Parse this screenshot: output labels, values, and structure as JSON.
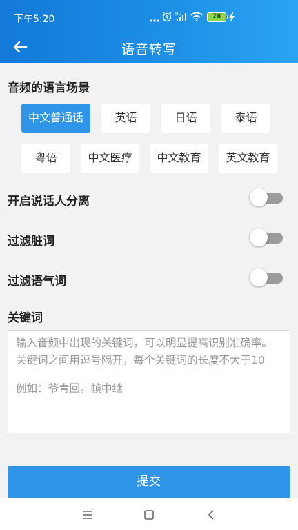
{
  "status_bar": {
    "time": "下午5:20",
    "battery": "78",
    "icons": [
      "more-dots-icon",
      "alarm-icon",
      "signal-icon",
      "wifi-icon",
      "battery-icon",
      "charging-icon"
    ]
  },
  "header": {
    "title": "语音转写",
    "back_icon": "arrow-left-icon",
    "color_start": "#1279d8",
    "color_end": "#2aa4f2"
  },
  "language": {
    "label": "音频的语言场景",
    "options": [
      "中文普通话",
      "英语",
      "日语",
      "泰语",
      "粤语",
      "中文医疗",
      "中文教育",
      "英文教育"
    ],
    "selected": "中文普通话",
    "accent": "#2f95e8"
  },
  "toggles": [
    {
      "label": "开启说话人分离",
      "on": false
    },
    {
      "label": "过滤脏词",
      "on": false
    },
    {
      "label": "过滤语气词",
      "on": false
    }
  ],
  "keywords": {
    "label": "关键词",
    "placeholder": "输入音频中出现的关键词，可以明显提高识别准确率。关键词之间用逗号隔开，每个关键词的长度不大于10",
    "example": "例如：爷青回，帧中继"
  },
  "submit": {
    "label": "提交"
  },
  "nav_bar": {
    "icons": [
      "menu-icon",
      "home-square-icon",
      "back-chevron-icon"
    ]
  }
}
